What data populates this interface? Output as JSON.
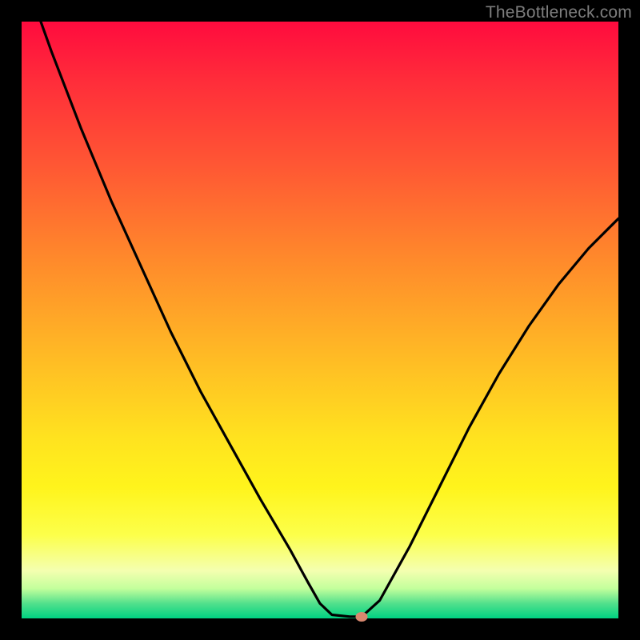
{
  "watermark": "TheBottleneck.com",
  "colors": {
    "frame": "#000000",
    "curve": "#000000",
    "marker": "#d8886f"
  },
  "chart_data": {
    "type": "line",
    "title": "",
    "xlabel": "",
    "ylabel": "",
    "xlim": [
      0,
      100
    ],
    "ylim": [
      0,
      100
    ],
    "grid": false,
    "legend": false,
    "series": [
      {
        "name": "bottleneck-curve",
        "x": [
          0,
          5,
          10,
          15,
          20,
          25,
          30,
          35,
          40,
          45,
          48,
          50,
          52,
          55,
          57,
          60,
          65,
          70,
          75,
          80,
          85,
          90,
          95,
          100
        ],
        "y": [
          109,
          95,
          82,
          70,
          59,
          48,
          38,
          29,
          20,
          11.5,
          6,
          2.5,
          0.6,
          0.3,
          0.3,
          3,
          12,
          22,
          32,
          41,
          49,
          56,
          62,
          67
        ]
      }
    ],
    "marker": {
      "x": 57,
      "y": 0.3
    },
    "note": "Y is bottleneck percentage (0 at bottom = balanced, green; high at top = severe bottleneck, red). X is relative component performance (arbitrary units). V-shaped curve with minimum near x≈55."
  }
}
